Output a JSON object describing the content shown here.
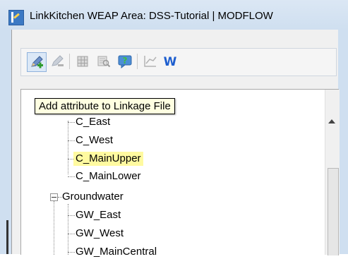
{
  "window": {
    "title": "LinkKitchen   WEAP Area: DSS-Tutorial | MODFLOW"
  },
  "toolbar": {
    "buttons": [
      {
        "icon": "pencil-add-icon",
        "state": "active"
      },
      {
        "icon": "pencil-remove-icon",
        "state": "disabled"
      },
      {
        "icon": "grid-icon",
        "state": "disabled"
      },
      {
        "icon": "table-search-icon",
        "state": "disabled"
      },
      {
        "icon": "help-chat-icon",
        "state": "enabled"
      },
      {
        "icon": "line-chart-icon",
        "state": "disabled"
      },
      {
        "icon": "weap-w-icon",
        "state": "enabled",
        "glyph": "W"
      }
    ]
  },
  "tooltip": {
    "text": "Add attribute to Linkage File"
  },
  "tree": {
    "items": [
      {
        "label": "C_East"
      },
      {
        "label": "C_West"
      },
      {
        "label": "C_MainUpper",
        "selected": true
      },
      {
        "label": "C_MainLower"
      },
      {
        "label": "Groundwater",
        "expander": "−"
      },
      {
        "label": "GW_East"
      },
      {
        "label": "GW_West"
      },
      {
        "label": "GW_MainCentral"
      }
    ]
  },
  "colors": {
    "selected_highlight": "#fffaa0",
    "tooltip_bg": "#ffffe1",
    "titlebar_bg": "#cfdff0",
    "weap_blue": "#1f5fcf"
  }
}
